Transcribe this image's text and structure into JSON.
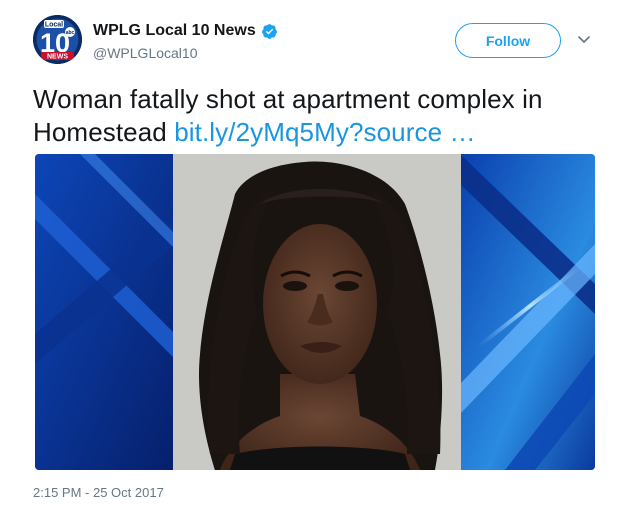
{
  "author": {
    "avatar_text_top": "Local",
    "avatar_number": "10",
    "avatar_text_bottom": "NEWS",
    "avatar_network": "abc",
    "name": "WPLG Local 10 News",
    "verified_icon": "verified-badge-icon",
    "handle": "@WPLGLocal10"
  },
  "actions": {
    "follow_label": "Follow",
    "more_icon": "chevron-down-icon"
  },
  "tweet": {
    "text": "Woman fatally shot at apartment complex in Homestead",
    "link": "bit.ly/2yMq5My?source …"
  },
  "media": {
    "kind": "photo",
    "description_icon": "mugshot-photo"
  },
  "meta": {
    "timestamp": "2:15 PM - 25 Oct 2017"
  },
  "colors": {
    "accent": "#1da1f2",
    "link": "#1b95e0",
    "secondary_text": "#657786",
    "verified": "#1da1f2"
  }
}
